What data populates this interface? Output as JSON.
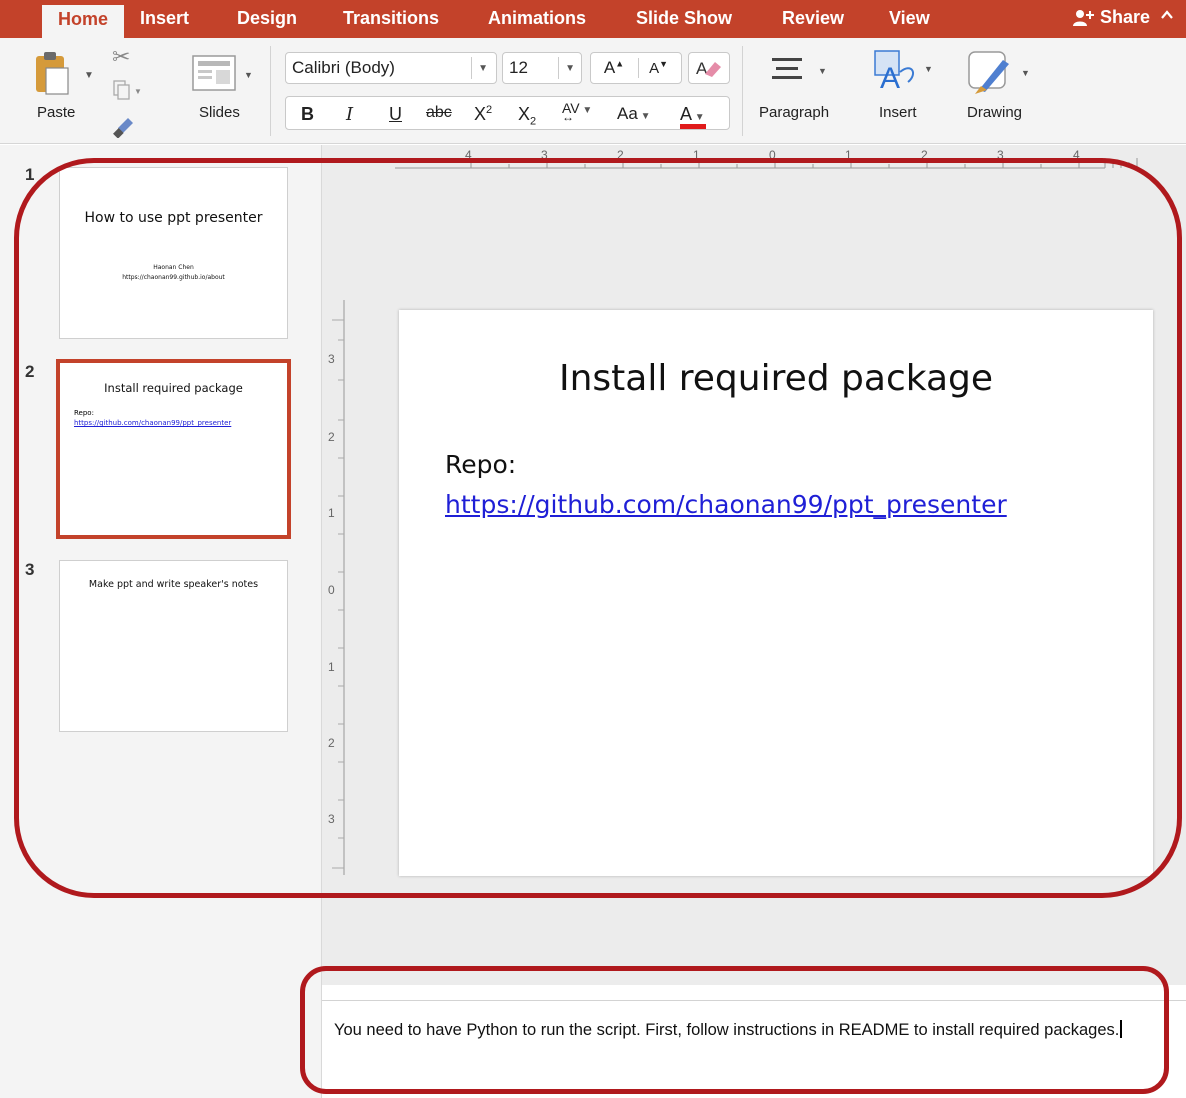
{
  "tabs": [
    {
      "label": "Home",
      "active": true
    },
    {
      "label": "Insert",
      "active": false
    },
    {
      "label": "Design",
      "active": false
    },
    {
      "label": "Transitions",
      "active": false
    },
    {
      "label": "Animations",
      "active": false
    },
    {
      "label": "Slide Show",
      "active": false
    },
    {
      "label": "Review",
      "active": false
    },
    {
      "label": "View",
      "active": false
    }
  ],
  "share_label": "Share",
  "ribbon": {
    "paste_label": "Paste",
    "slides_label": "Slides",
    "font_name": "Calibri (Body)",
    "font_size": "12",
    "paragraph_label": "Paragraph",
    "insert_label": "Insert",
    "drawing_label": "Drawing",
    "bold": "B",
    "italic": "I",
    "underline": "U",
    "strike": "abc",
    "grow_font": "A",
    "shrink_font": "A",
    "font_color_letter": "A"
  },
  "thumbnails": [
    {
      "number": "1",
      "title": "How to use ppt presenter",
      "line1": "Haonan Chen",
      "line2": "https://chaonan99.github.io/about"
    },
    {
      "number": "2",
      "title": "Install required package",
      "line1": "Repo:",
      "line2": "https://github.com/chaonan99/ppt_presenter"
    },
    {
      "number": "3",
      "title": "Make ppt and write speaker's notes"
    }
  ],
  "ruler": {
    "h_ticks": [
      "4",
      "3",
      "2",
      "1",
      "0",
      "1",
      "2",
      "3",
      "4"
    ],
    "v_ticks": [
      "3",
      "2",
      "1",
      "0",
      "1",
      "2",
      "3"
    ]
  },
  "slide": {
    "title": "Install required package",
    "repo_label": "Repo:",
    "repo_link": "https://github.com/chaonan99/ppt_presenter"
  },
  "notes": {
    "text": "You need to have Python to run the script. First, follow instructions in README to install required packages."
  },
  "colors": {
    "accent": "#c3422a",
    "highlight": "#b0191d",
    "link": "#1f1fd6"
  }
}
